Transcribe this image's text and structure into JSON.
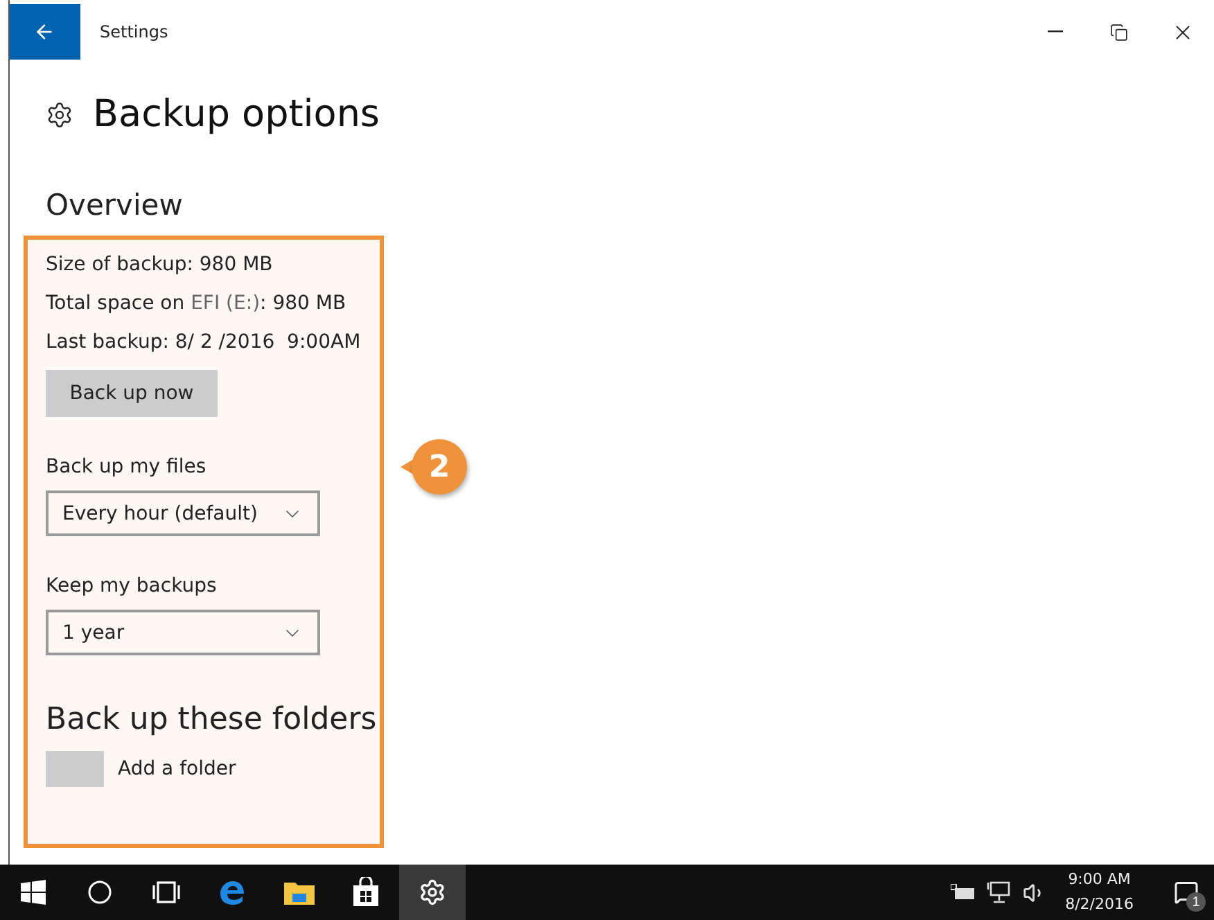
{
  "window": {
    "title": "Settings"
  },
  "page": {
    "heading": "Backup options"
  },
  "overview": {
    "heading": "Overview",
    "lines": [
      {
        "text": "Size of backup: 980 MB"
      },
      {
        "text": "Total space on ",
        "link": "EFI (E:)",
        "after": ": 980 MB"
      },
      {
        "text": "Last backup: 8/ 2 /2016  9:00AM"
      }
    ],
    "button": "Back up now",
    "dropdowns": [
      {
        "label": "Back up my files",
        "value": "Every hour (default)"
      },
      {
        "label": "Keep my backups",
        "value": "1 year"
      }
    ]
  },
  "folders": {
    "heading": "Back up these folders",
    "add_label": "Add a folder"
  },
  "callout": {
    "number": "2"
  },
  "taskbar": {
    "items": [
      {
        "kind": "start",
        "selected": false
      },
      {
        "kind": "search",
        "selected": false
      },
      {
        "kind": "taskview",
        "selected": false
      },
      {
        "kind": "edge",
        "selected": false
      },
      {
        "kind": "explorer",
        "selected": false
      },
      {
        "kind": "store",
        "selected": false
      },
      {
        "kind": "settings",
        "selected": true
      }
    ],
    "time": "9:00 AM",
    "date": "8/2/2016",
    "notifications": "1"
  }
}
